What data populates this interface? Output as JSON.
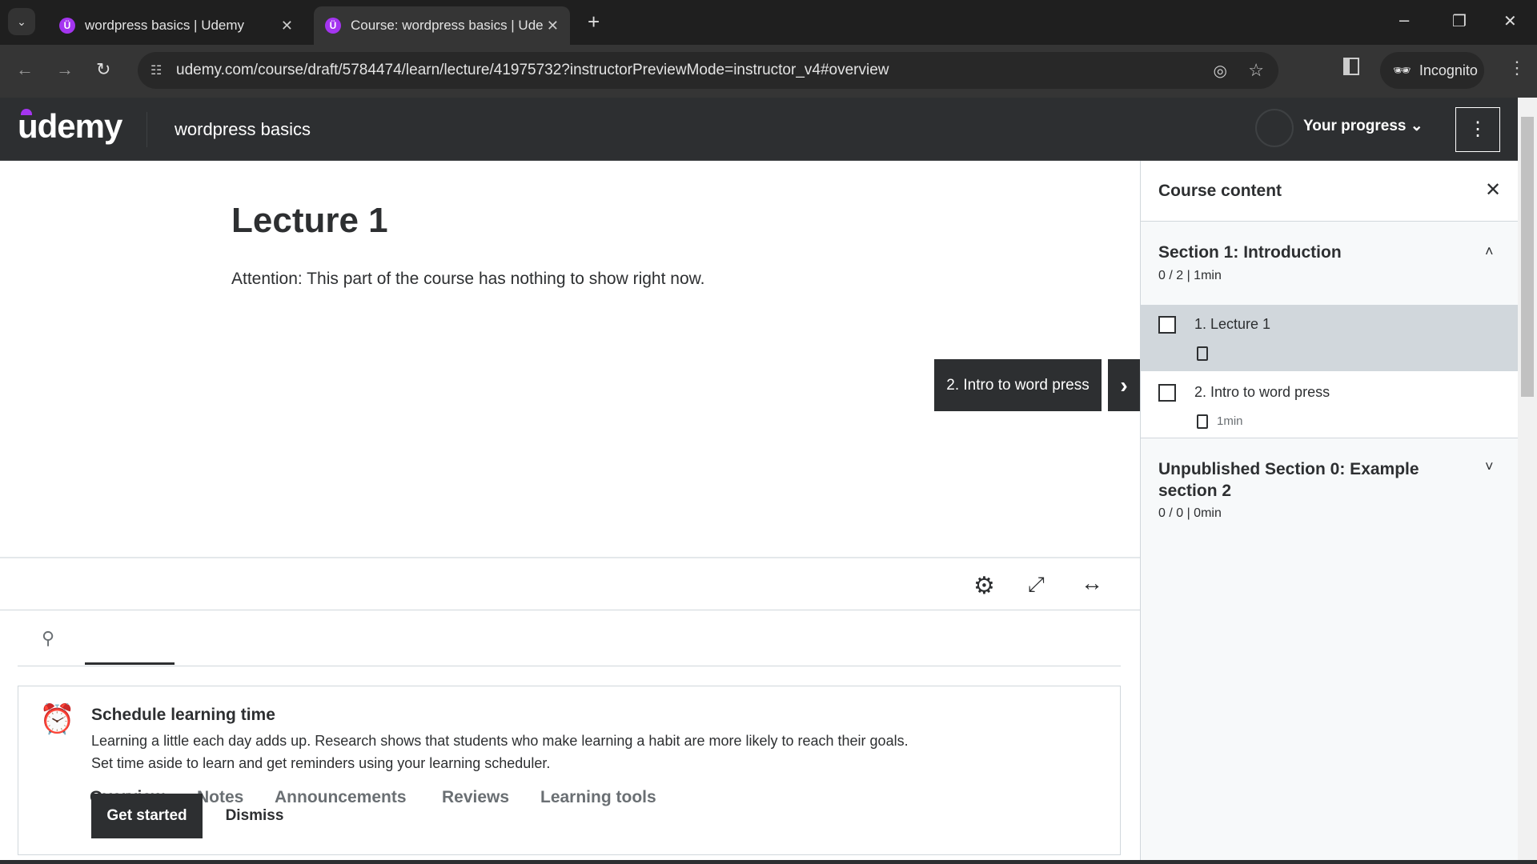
{
  "browser": {
    "tabs": [
      {
        "title": "wordpress basics | Udemy"
      },
      {
        "title": "Course: wordpress basics | Ude"
      }
    ],
    "url": "udemy.com/course/draft/5784474/learn/lecture/41975732?instructorPreviewMode=instructor_v4#overview",
    "incognito_label": "Incognito"
  },
  "header": {
    "logo": "udemy",
    "course_title": "wordpress basics",
    "progress_label": "Your progress",
    "brand_color": "#a435f0"
  },
  "lecture": {
    "title": "Lecture 1",
    "message": "Attention: This part of the course has nothing to show right now.",
    "next_label": "2. Intro to word press"
  },
  "tabs": [
    {
      "label": "Overview"
    },
    {
      "label": "Notes"
    },
    {
      "label": "Announcements"
    },
    {
      "label": "Reviews"
    },
    {
      "label": "Learning tools"
    }
  ],
  "schedule": {
    "title": "Schedule learning time",
    "line1": "Learning a little each day adds up. Research shows that students who make learning a habit are more likely to reach their goals.",
    "line2": "Set time aside to learn and get reminders using your learning scheduler.",
    "get_started": "Get started",
    "dismiss": "Dismiss"
  },
  "sidebar": {
    "title": "Course content",
    "sections": [
      {
        "title": "Section 1: Introduction",
        "meta": "0 / 2 | 1min",
        "items": [
          {
            "label": "1. Lecture 1",
            "duration": ""
          },
          {
            "label": "2. Intro to word press",
            "duration": "1min"
          }
        ]
      },
      {
        "title": "Unpublished Section 0: Example section 2",
        "meta": "0 / 0 | 0min"
      }
    ]
  }
}
